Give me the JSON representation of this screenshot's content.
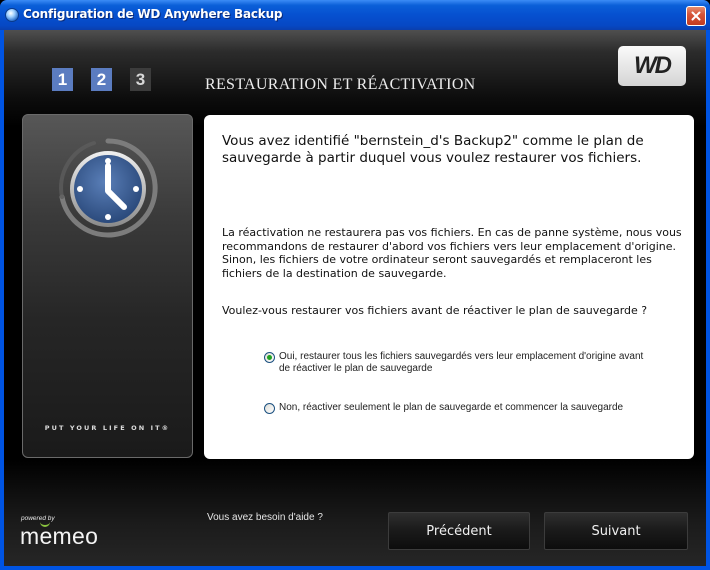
{
  "window": {
    "title": "Configuration de WD Anywhere Backup",
    "icon": "app-icon",
    "close_icon": "close-icon"
  },
  "header": {
    "steps": [
      {
        "label": "1",
        "state": "done"
      },
      {
        "label": "2",
        "state": "active"
      },
      {
        "label": "3",
        "state": "pending"
      }
    ],
    "title": "RESTAURATION ET RÉACTIVATION",
    "logo_text": "WD"
  },
  "sidebar": {
    "illustration": "clock-icon",
    "tagline": "PUT YOUR LIFE ON IT®"
  },
  "content": {
    "identified_text": "Vous avez identifié \"bernstein_d's Backup2\" comme le plan de sauvegarde à partir duquel vous voulez restaurer vos fichiers.",
    "warning_text": "La réactivation ne restaurera pas vos fichiers.  En cas de panne système, nous vous recommandons de restaurer d'abord vos fichiers vers leur emplacement d'origine.  Sinon, les fichiers de votre ordinateur seront sauvegardés et remplaceront les fichiers de la destination de sauvegarde.",
    "question": "Voulez-vous restaurer vos fichiers avant de réactiver le plan de sauvegarde ?",
    "options": [
      {
        "label": "Oui, restaurer tous les fichiers sauvegardés vers leur emplacement d'origine avant de réactiver le plan de sauvegarde",
        "selected": true
      },
      {
        "label": "Non, réactiver seulement le plan de sauvegarde et commencer la sauvegarde",
        "selected": false
      }
    ]
  },
  "footer": {
    "powered_by": "powered by",
    "brand": "memeo",
    "help_text": "Vous avez besoin d'aide ?",
    "prev_label": "Précédent",
    "next_label": "Suivant"
  },
  "colors": {
    "titlebar": "#0054e3",
    "step_active": "#5b7cc0",
    "step_pending": "#3c3c3c",
    "radio_dot": "#21a121",
    "memeo_accent": "#8bc53f",
    "clock_face": "#3d5f96"
  }
}
